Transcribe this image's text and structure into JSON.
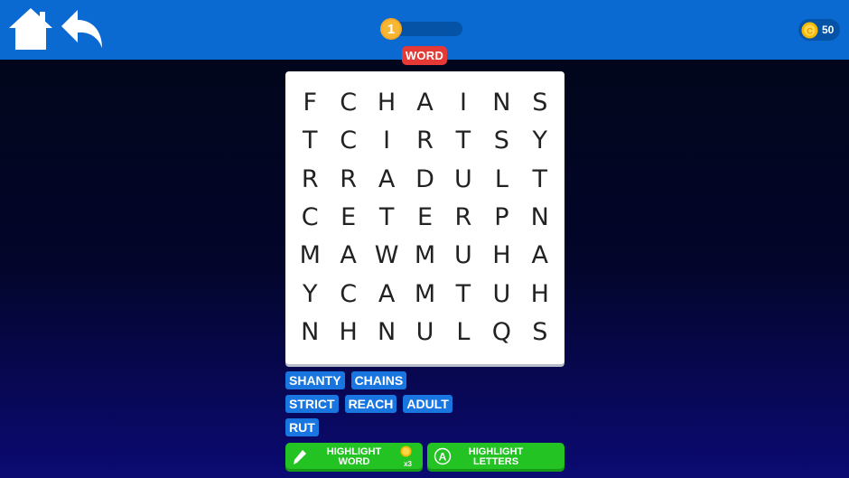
{
  "header": {
    "level": "1",
    "level_progress": 0.05,
    "level_label": "WORD",
    "coins": "50",
    "home_icon": "home-icon",
    "back_icon": "undo-arrow-icon"
  },
  "grid": [
    [
      "F",
      "C",
      "H",
      "A",
      "I",
      "N",
      "S"
    ],
    [
      "T",
      "C",
      "I",
      "R",
      "T",
      "S",
      "Y"
    ],
    [
      "R",
      "R",
      "A",
      "D",
      "U",
      "L",
      "T"
    ],
    [
      "C",
      "E",
      "T",
      "E",
      "R",
      "P",
      "N"
    ],
    [
      "M",
      "A",
      "W",
      "M",
      "U",
      "H",
      "A"
    ],
    [
      "Y",
      "C",
      "A",
      "M",
      "T",
      "U",
      "H"
    ],
    [
      "N",
      "H",
      "N",
      "U",
      "L",
      "Q",
      "S"
    ]
  ],
  "word_rows": [
    [
      "SHANTY",
      "CHAINS"
    ],
    [
      "STRICT",
      "REACH",
      "ADULT"
    ],
    [
      "RUT"
    ]
  ],
  "powerups": {
    "highlight_word": {
      "line1": "HIGHLIGHT",
      "line2": "WORD",
      "multiplier": "x3",
      "icon": "pencil-icon"
    },
    "highlight_letters": {
      "line1": "HIGHLIGHT",
      "line2": "LETTERS",
      "icon": "letter-a-icon"
    }
  },
  "colors": {
    "topbar": "#0a6ad2",
    "word_chip": "#1976e0",
    "powerup_green": "#22c322",
    "level_badge": "#f5a623",
    "word_badge": "#e53935"
  }
}
